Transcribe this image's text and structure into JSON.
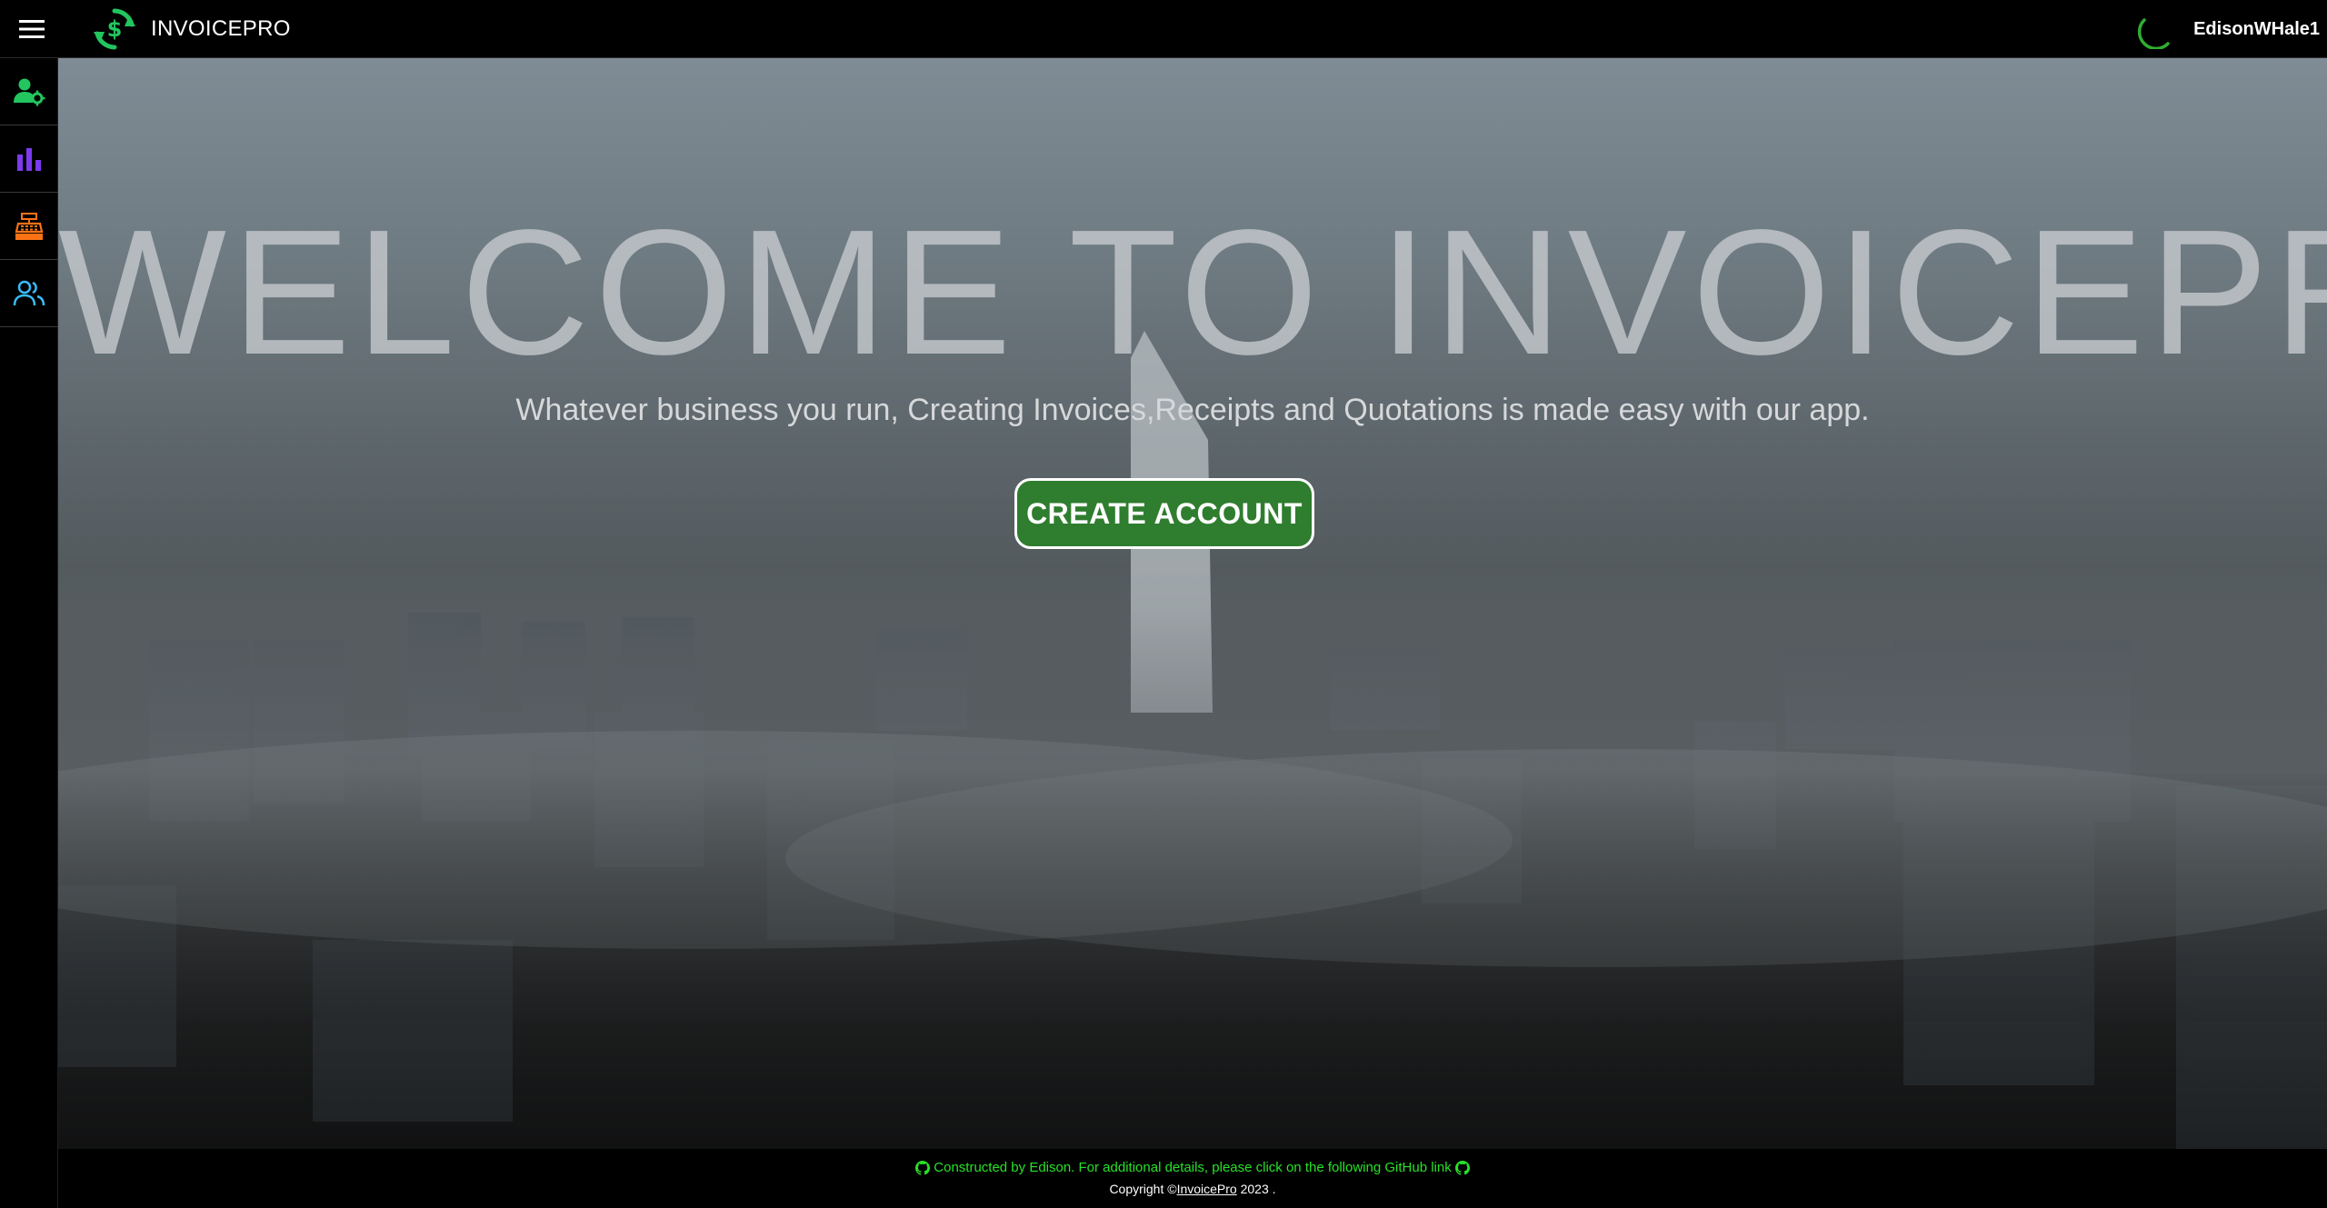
{
  "app": {
    "brand_name": "INVOICEPRO",
    "username": "EdisonWHale1"
  },
  "sidebar": {
    "items": [
      {
        "name": "user-settings",
        "icon": "user-gear-icon",
        "color": "#22c55e"
      },
      {
        "name": "analytics",
        "icon": "bar-chart-icon",
        "color": "#7c3aed"
      },
      {
        "name": "cash-register",
        "icon": "cash-register-icon",
        "color": "#f97316"
      },
      {
        "name": "users",
        "icon": "users-icon",
        "color": "#38bdf8"
      }
    ]
  },
  "hero": {
    "title": "WELCOME TO INVOICEPRO",
    "subtitle": "Whatever business you run, Creating Invoices,Receipts and Quotations is made easy with our app.",
    "cta_label": "CREATE ACCOUNT",
    "cta_color": "#2f7d2f"
  },
  "footer": {
    "credit": "Constructed by Edison. For additional details, please click on the following GitHub link",
    "copyright_prefix": "Copyright ©",
    "copyright_link": "InvoicePro",
    "copyright_suffix": " 2023 .",
    "accent": "#27e227"
  }
}
